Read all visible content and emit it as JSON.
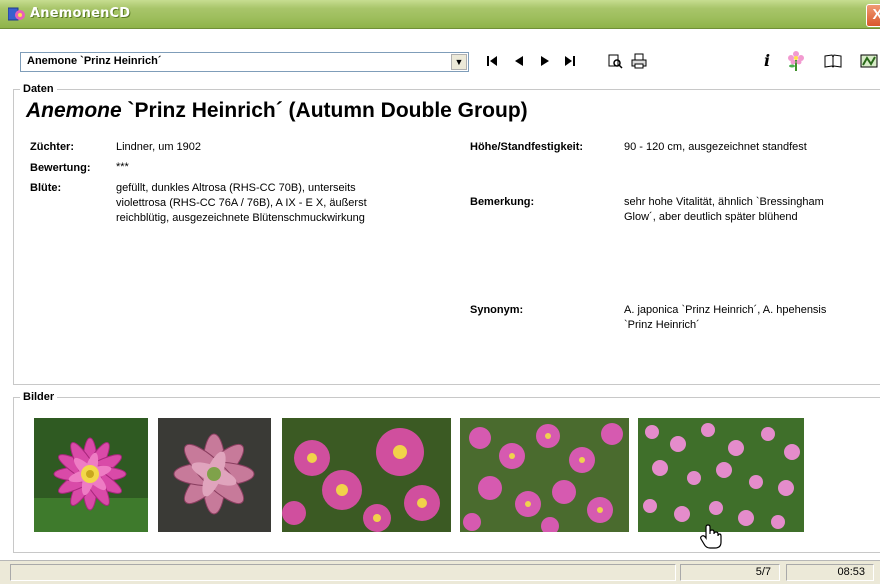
{
  "window": {
    "title": "AnemonenCD",
    "close_label": "X"
  },
  "toolbar": {
    "variety_select": "Anemone `Prinz Heinrich´",
    "nav_icons": [
      "first-record-icon",
      "previous-record-icon",
      "next-record-icon",
      "last-record-icon"
    ],
    "tool_icons": [
      "search-icon",
      "print-icon"
    ],
    "right_icons": [
      "info-icon",
      "flower-icon",
      "book-icon",
      "map-icon"
    ],
    "info_label": "i"
  },
  "daten": {
    "legend": "Daten",
    "heading_italic": "Anemone",
    "heading_rest": " `Prinz Heinrich´ (Autumn Double Group)",
    "zuechter_label": "Züchter:",
    "zuechter_value": "Lindner, um 1902",
    "bewertung_label": "Bewertung:",
    "bewertung_value": "***",
    "bluete_label": "Blüte:",
    "bluete_value": "gefüllt, dunkles Altrosa (RHS-CC 70B), unterseits violettrosa (RHS-CC 76A / 76B), A IX - E X, äußerst reichblütig, ausgezeichnete Blütenschmuckwirkung",
    "hoehe_label": "Höhe/Standfestigkeit:",
    "hoehe_value": "90 - 120 cm, ausgezeichnet standfest",
    "bemerkung_label": "Bemerkung:",
    "bemerkung_value": "sehr hohe Vitalität, ähnlich `Bressingham Glow´, aber deutlich später blühend",
    "synonym_label": "Synonym:",
    "synonym_value": "A. japonica `Prinz Heinrich´, A. hpehensis `Prinz Heinrich´"
  },
  "bilder": {
    "legend": "Bilder",
    "count": 5
  },
  "status": {
    "record": "5/7",
    "time": "08:53"
  },
  "colors": {
    "titlebar": "#9fbf5e",
    "flower_pink": "#d94aa8",
    "foliage": "#3f6f2a"
  }
}
